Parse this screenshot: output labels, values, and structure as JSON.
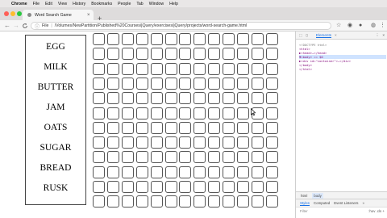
{
  "menubar": {
    "apple": "",
    "items": [
      "Chrome",
      "File",
      "Edit",
      "View",
      "History",
      "Bookmarks",
      "People",
      "Tab",
      "Window",
      "Help"
    ]
  },
  "browser": {
    "tab_title": "Word Search Game",
    "tab_close": "×",
    "new_tab": "+",
    "url_scheme": "File",
    "url": "/Volumes/NewPartition/Published%20Courses/jQuery/exercises/jQuery/projects/word-search-game.html",
    "nav": {
      "back": "←",
      "forward": "→",
      "reload": "C"
    }
  },
  "words": [
    "EGG",
    "MILK",
    "BUTTER",
    "JAM",
    "OATS",
    "SUGAR",
    "BREAD",
    "RUSK"
  ],
  "grid": {
    "rows": 12,
    "cols": 13
  },
  "devtools": {
    "tab_elements": "Elements",
    "tab_close": "×",
    "menu": "⋮",
    "close": "×",
    "dom_lines": [
      "<!DOCTYPE html>",
      "<html>",
      "  ▶<head>…</head>",
      "  ▼<body> == $0",
      "    ▶<div id=\"container\">…</div>",
      "    </body>",
      "</html>"
    ],
    "crumbs": [
      "html",
      "body"
    ],
    "style_tabs": [
      "Styles",
      "Computed",
      "Event Listeners",
      "»"
    ],
    "filter_placeholder": "Filter",
    "filter_right": ":hov .cls +"
  },
  "colors": {
    "accent": "#1a73e8",
    "close_light": "#fe5f57",
    "min_light": "#febc2e",
    "max_light": "#28c840"
  }
}
